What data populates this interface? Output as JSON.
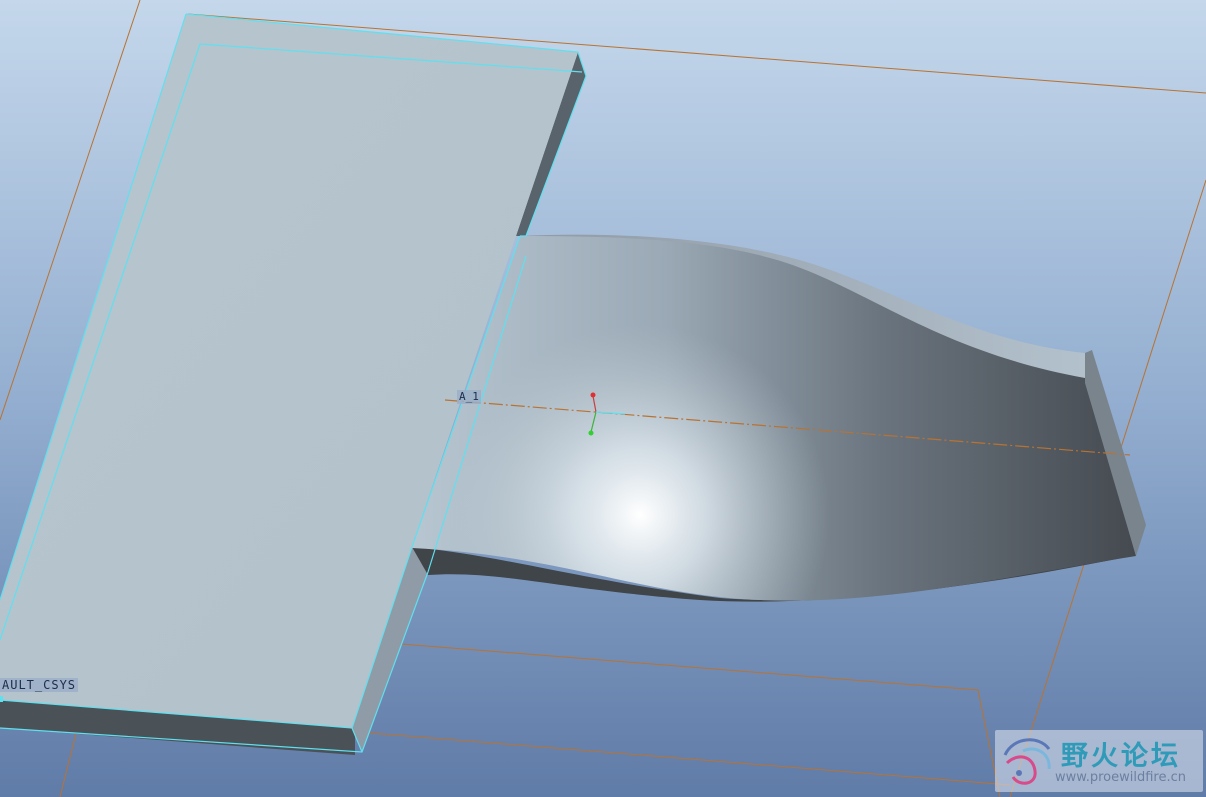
{
  "viewport": {
    "background_top": "#c3d6ea",
    "background_bottom": "#5e7aa6",
    "datum_color": "#b87333",
    "highlight_color": "#5fe0ef",
    "model_face_color": "#b8c4cc"
  },
  "labels": {
    "axis_tag": "A_1",
    "csys_tag": "AULT_CSYS"
  },
  "watermark": {
    "title": "野火论坛",
    "url": "www.proewildfire.cn"
  }
}
